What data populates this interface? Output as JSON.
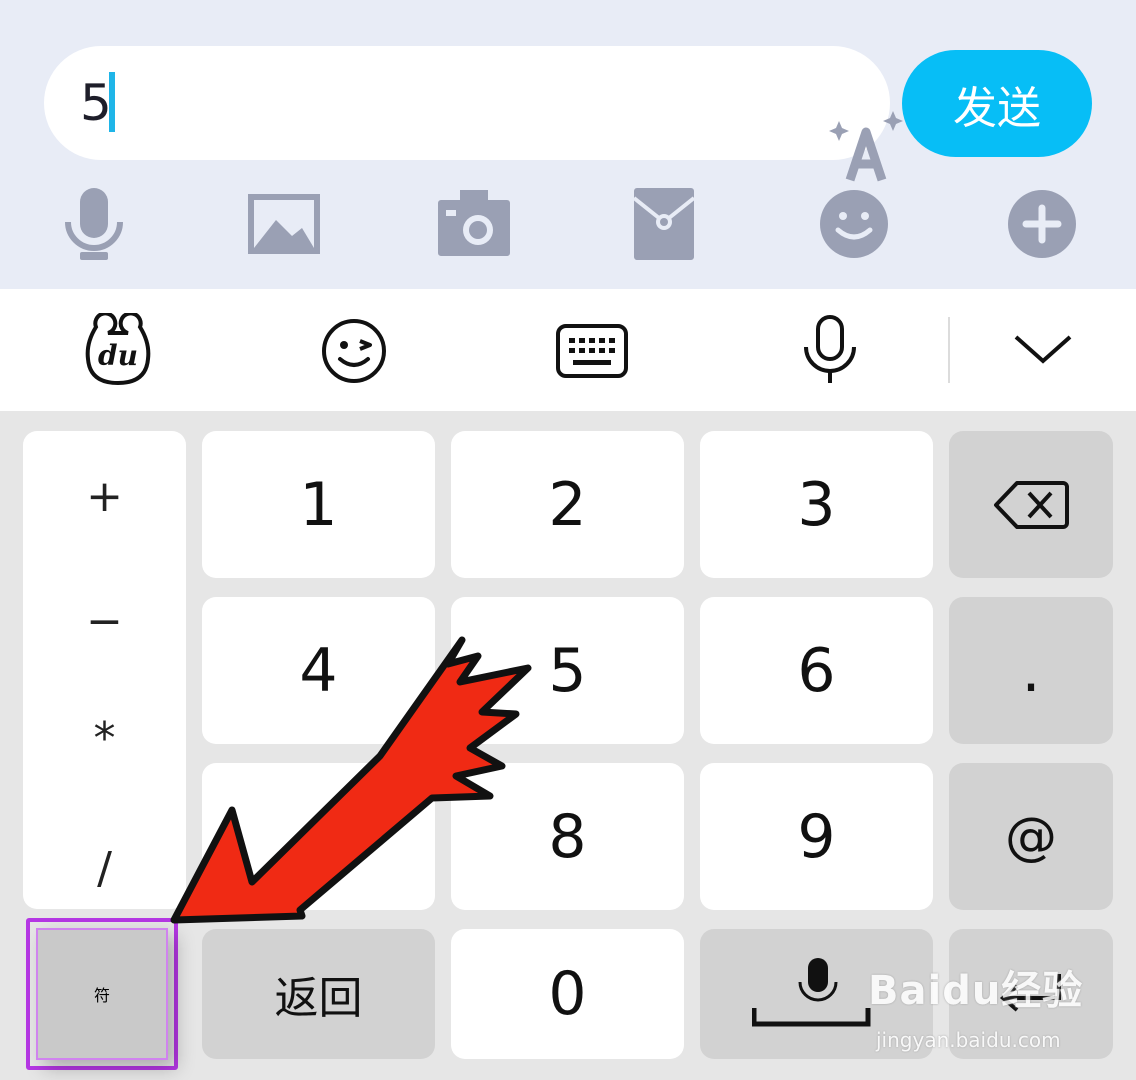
{
  "input": {
    "value": "5"
  },
  "send_button": {
    "label": "发送"
  },
  "toolbar_icons": [
    "microphone-icon",
    "image-icon",
    "camera-icon",
    "red-packet-icon",
    "emoji-icon",
    "plus-icon"
  ],
  "ime_bar_icons": [
    "du-bear-logo-icon",
    "wink-emoji-icon",
    "keyboard-icon",
    "microphone-icon",
    "chevron-down-icon"
  ],
  "keyboard": {
    "symbols": [
      "+",
      "−",
      "*",
      "/"
    ],
    "keys": {
      "k1": "1",
      "k2": "2",
      "k3": "3",
      "k4": "4",
      "k5": "5",
      "k6": "6",
      "k8": "8",
      "k9": "9",
      "dot": ".",
      "at": "@",
      "k0": "0",
      "symbols_toggle": "符",
      "back": "返回"
    }
  },
  "watermark": {
    "brand": "Baidu经验",
    "url": "jingyan.baidu.com"
  },
  "colors": {
    "accent": "#07bef6",
    "highlight": "#b537e4",
    "arrow": "#f02a14",
    "chat_bg": "#e8ecf6",
    "icon_gray": "#9aa0b4"
  }
}
